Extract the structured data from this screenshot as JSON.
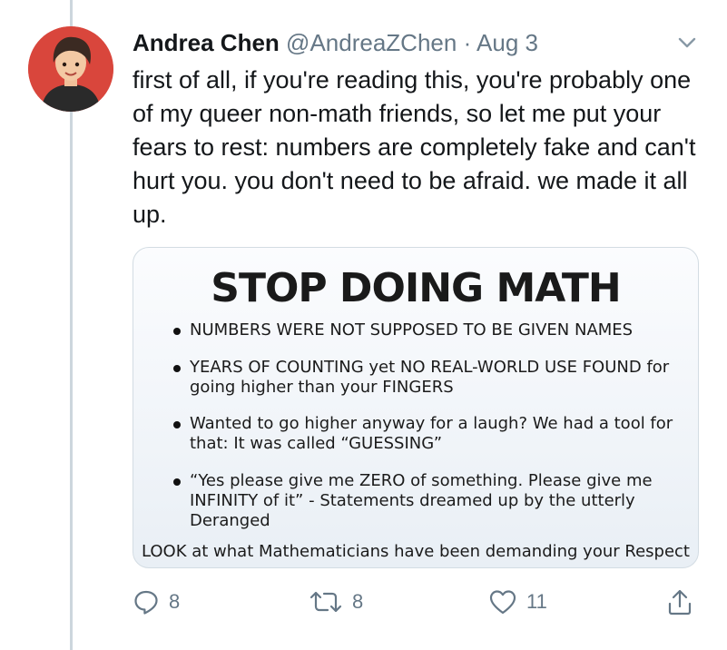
{
  "tweet": {
    "author_name": "Andrea Chen",
    "handle": "@AndreaZChen",
    "separator": "·",
    "date": "Aug 3",
    "text": "first of all, if you're reading this, you're probably one of my queer non-math friends, so let me put your fears to rest: numbers are completely fake and can't hurt you. you don't need to be afraid. we made it all up."
  },
  "meme": {
    "title": "STOP DOING MATH",
    "bullets": [
      "NUMBERS WERE NOT SUPPOSED TO BE GIVEN NAMES",
      "YEARS OF COUNTING yet NO REAL-WORLD USE FOUND for going higher than your FINGERS",
      "Wanted to go higher anyway for a laugh? We had a tool for that: It was called “GUESSING”",
      "“Yes please give me ZERO of something. Please give me INFINITY of it” - Statements dreamed up by the utterly Deranged"
    ],
    "footer": "LOOK at what Mathematicians have been demanding your Respect"
  },
  "actions": {
    "reply_count": "8",
    "retweet_count": "8",
    "like_count": "11"
  },
  "icons": {
    "reply": "reply-icon",
    "retweet": "retweet-icon",
    "like": "like-icon",
    "share": "share-icon",
    "menu": "chevron-down-icon"
  },
  "colors": {
    "avatar_bg": "#d9463c",
    "secondary_text": "#657786",
    "thread_line": "#ccd6dd"
  }
}
